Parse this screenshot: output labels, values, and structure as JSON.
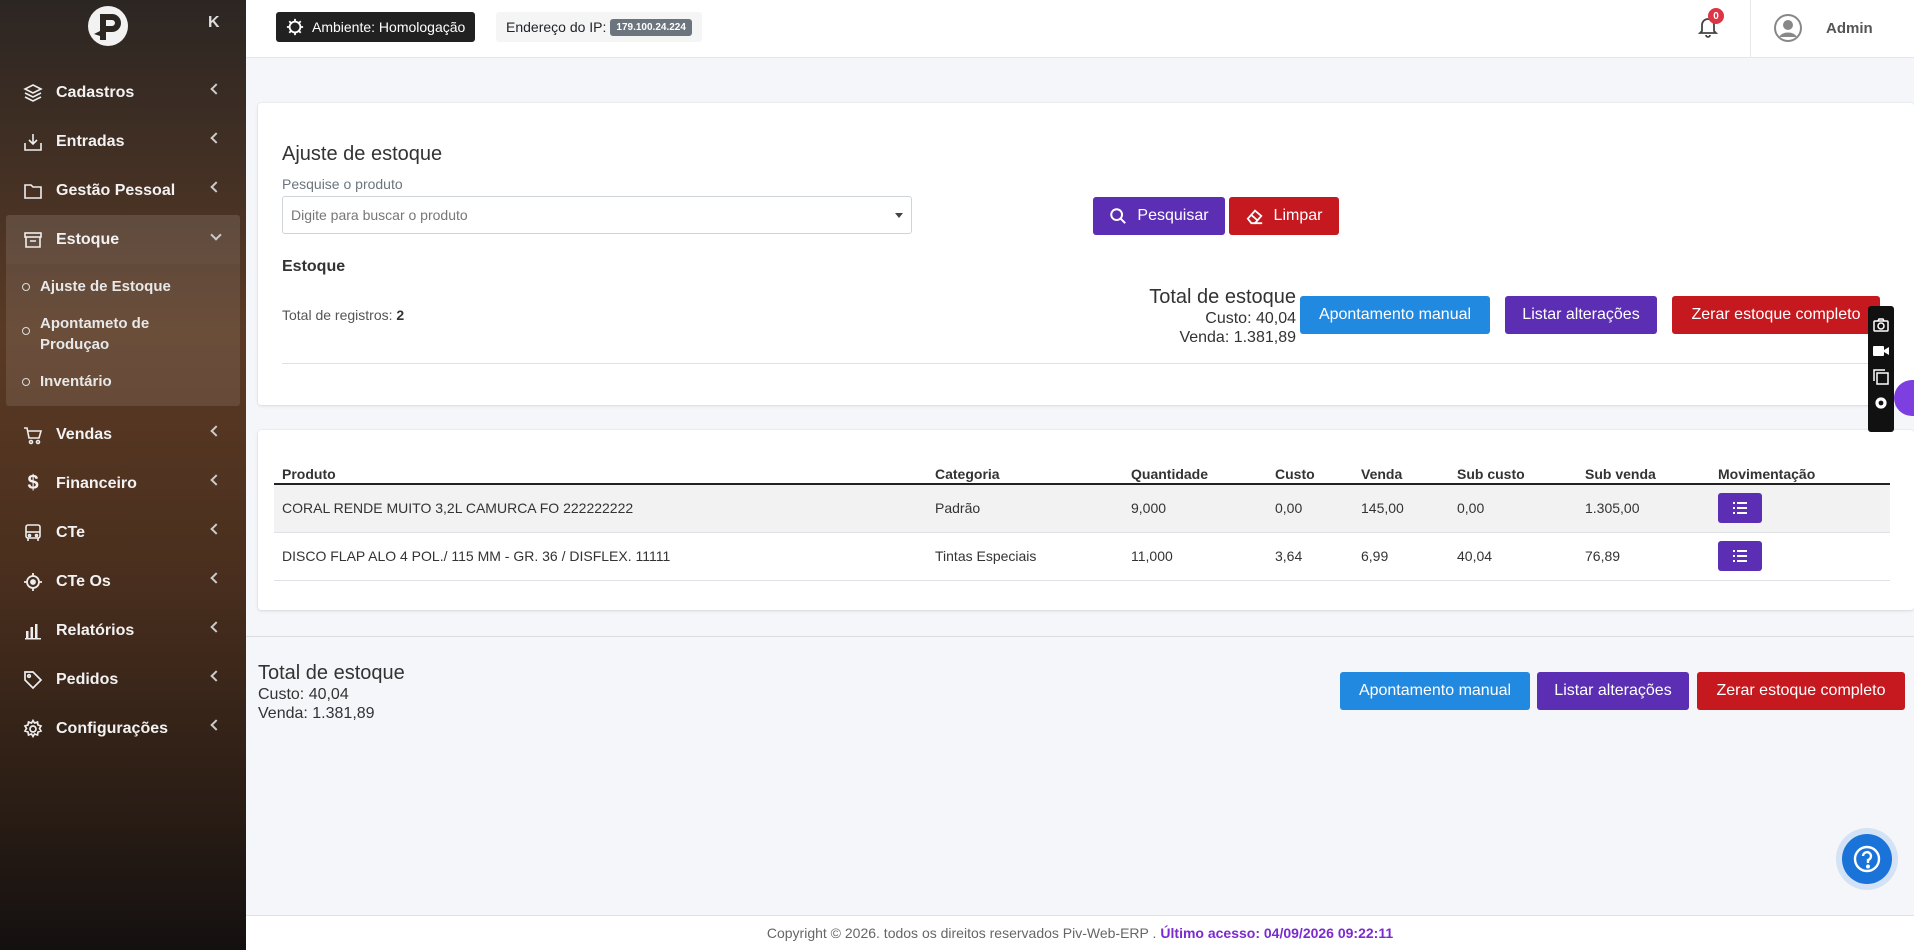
{
  "sidebar": {
    "collapse_label": "K",
    "items": [
      {
        "label": "Cadastros",
        "icon": "layers-icon"
      },
      {
        "label": "Entradas",
        "icon": "download-tray-icon"
      },
      {
        "label": "Gestão Pessoal",
        "icon": "folder-icon"
      },
      {
        "label": "Estoque",
        "icon": "archive-icon",
        "open": true
      },
      {
        "label": "Vendas",
        "icon": "cart-icon"
      },
      {
        "label": "Financeiro",
        "icon": "dollar-icon"
      },
      {
        "label": "CTe",
        "icon": "bus-icon"
      },
      {
        "label": "CTe Os",
        "icon": "target-icon"
      },
      {
        "label": "Relatórios",
        "icon": "bar-chart-icon"
      },
      {
        "label": "Pedidos",
        "icon": "tag-icon"
      },
      {
        "label": "Configurações",
        "icon": "gear-icon"
      }
    ],
    "submenu": [
      "Ajuste de Estoque",
      "Apontameto de Produçao",
      "Inventário"
    ]
  },
  "topbar": {
    "environment": "Ambiente: Homologação",
    "ip_label": "Endereço do IP:",
    "ip_value": "179.100.24.224",
    "notifications": "0",
    "user": "Admin"
  },
  "main": {
    "title": "Ajuste de estoque",
    "search_label": "Pesquise o produto",
    "search_placeholder": "Digite para buscar o produto",
    "search_button": "Pesquisar",
    "clear_button": "Limpar",
    "section_label": "Estoque",
    "records_label": "Total de registros:",
    "records_count": "2",
    "totals_title": "Total de estoque",
    "custo": "Custo: 40,04",
    "venda": "Venda: 1.381,89",
    "btn_apontamento": "Apontamento manual",
    "btn_listar": "Listar alterações",
    "btn_zerar": "Zerar estoque completo"
  },
  "table": {
    "headers": [
      "Produto",
      "Categoria",
      "Quantidade",
      "Custo",
      "Venda",
      "Sub custo",
      "Sub venda",
      "Movimentação"
    ],
    "rows": [
      [
        "CORAL RENDE MUITO 3,2L CAMURCA FO 222222222",
        "Padrão",
        "9,000",
        "0,00",
        "145,00",
        "0,00",
        "1.305,00"
      ],
      [
        "DISCO FLAP ALO 4 POL./ 115 MM - GR. 36 / DISFLEX. 11111",
        "Tintas Especiais",
        "11,000",
        "3,64",
        "6,99",
        "40,04",
        "76,89"
      ]
    ]
  },
  "footer": {
    "copyright": "Copyright © 2026. todos os direitos reservados Piv-Web-ERP .",
    "last_access": "Último acesso: 04/09/2026 09:22:11"
  },
  "colors": {
    "purple": "#5b2eb3",
    "red": "#c5181f",
    "blue": "#2189e0",
    "accent": "#7b2ad0"
  }
}
